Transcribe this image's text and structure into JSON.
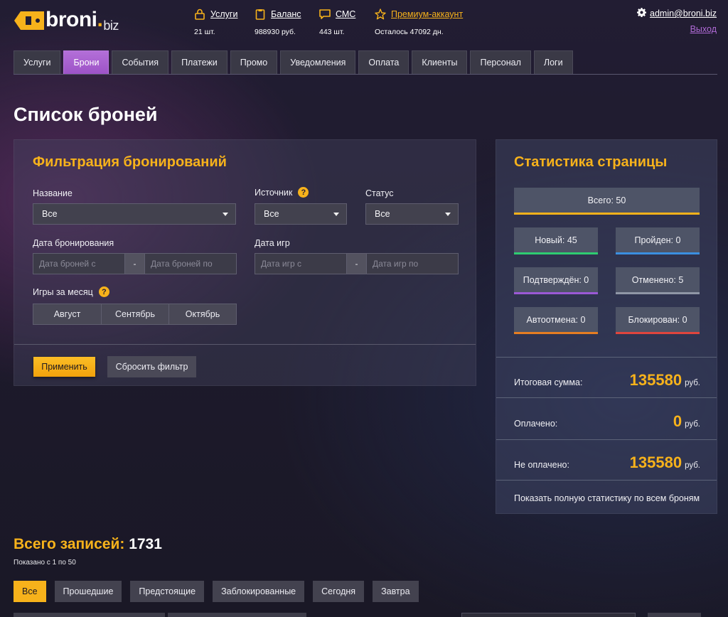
{
  "brand": {
    "name": "broni",
    "dot": ".",
    "tld": "biz"
  },
  "topstats": [
    {
      "label": "Услуги",
      "sub": "21 шт.",
      "icon": "lock-icon"
    },
    {
      "label": "Баланс",
      "sub": "988930 руб.",
      "icon": "wallet-icon"
    },
    {
      "label": "СМС",
      "sub": "443 шт.",
      "icon": "message-icon"
    },
    {
      "label": "Премиум-аккаунт",
      "sub": "Осталось 47092 дн.",
      "icon": "star-icon"
    }
  ],
  "account": {
    "email": "admin@broni.biz",
    "logout": "Выход",
    "icon": "gear-icon"
  },
  "tabs": [
    "Услуги",
    "Брони",
    "События",
    "Платежи",
    "Промо",
    "Уведомления",
    "Оплата",
    "Клиенты",
    "Персонал",
    "Логи"
  ],
  "active_tab": "Брони",
  "page_title": "Список броней",
  "filter": {
    "title": "Фильтрация бронирований",
    "name_label": "Название",
    "name_value": "Все",
    "source_label": "Источник",
    "source_value": "Все",
    "status_label": "Статус",
    "status_value": "Все",
    "booking_date_label": "Дата бронирования",
    "booking_from_placeholder": "Дата броней с",
    "booking_to_placeholder": "Дата броней по",
    "games_date_label": "Дата игр",
    "games_from_placeholder": "Дата игр с",
    "games_to_placeholder": "Дата игр по",
    "range_sep": "-",
    "help_mark": "?",
    "month_label": "Игры за месяц",
    "months": [
      "Август",
      "Сентябрь",
      "Октябрь"
    ],
    "apply": "Применить",
    "reset": "Сбросить фильтр"
  },
  "stats": {
    "title": "Статистика страницы",
    "total": "Всего: 50",
    "boxes": [
      {
        "label": "Новый: 45",
        "color": "#2ecc71"
      },
      {
        "label": "Пройден: 0",
        "color": "#3b8fe0"
      },
      {
        "label": "Подтверждён: 0",
        "color": "#9b59d6"
      },
      {
        "label": "Отменено: 5",
        "color": "#8f96a6"
      },
      {
        "label": "Автоотмена: 0",
        "color": "#e67e22"
      },
      {
        "label": "Блокирован: 0",
        "color": "#e0453d"
      }
    ],
    "total_accent": "#f7b21b",
    "sum_label": "Итоговая сумма:",
    "sum_value": "135580",
    "paid_label": "Оплачено:",
    "paid_value": "0",
    "unpaid_label": "Не оплачено:",
    "unpaid_value": "135580",
    "currency": "руб.",
    "full_link": "Показать полную статистику по всем броням"
  },
  "records": {
    "total_label": "Всего записей:",
    "total_value": "1731",
    "shown": "Показано с 1 по 50",
    "quick_filters": [
      "Все",
      "Прошедшие",
      "Предстоящие",
      "Заблокированные",
      "Сегодня",
      "Завтра"
    ],
    "active_filter": "Все"
  }
}
